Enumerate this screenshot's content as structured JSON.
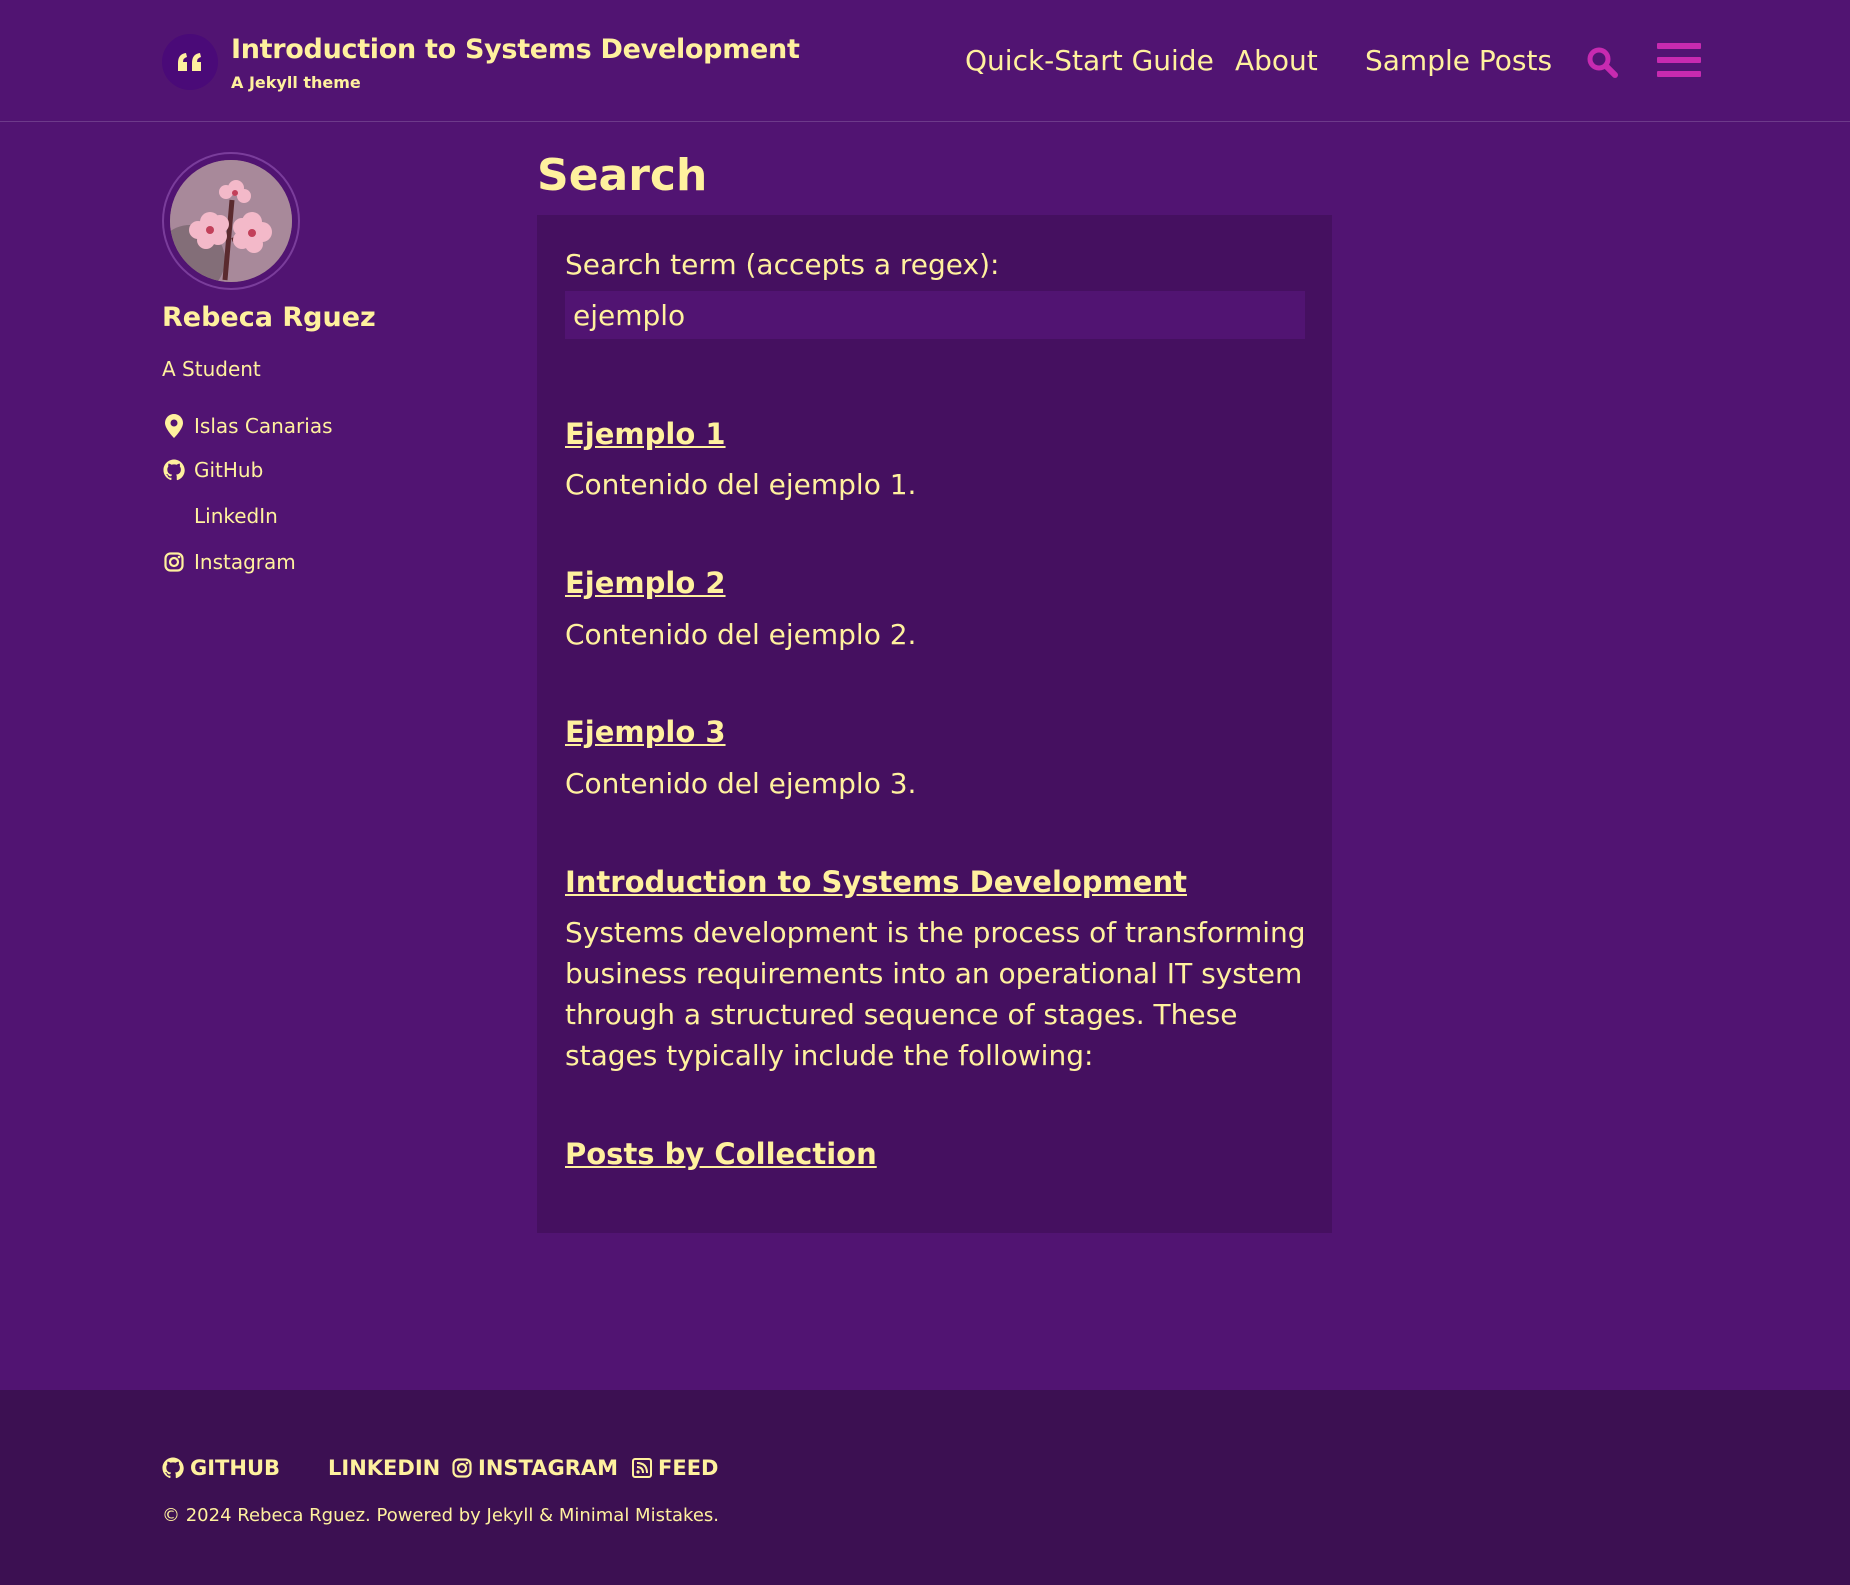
{
  "header": {
    "site_title": "Introduction to Systems Development",
    "site_subtitle": "A Jekyll theme",
    "nav": [
      "Quick-Start Guide",
      "About",
      "Sample Posts"
    ],
    "accent_color": "#c72ab0"
  },
  "sidebar": {
    "author_name": "Rebeca Rguez",
    "author_bio": "A Student",
    "links": [
      {
        "label": "Islas Canarias",
        "icon": "map-marker-icon"
      },
      {
        "label": "GitHub",
        "icon": "github-icon"
      },
      {
        "label": "LinkedIn",
        "icon": "linkedin-icon"
      },
      {
        "label": "Instagram",
        "icon": "instagram-icon"
      }
    ]
  },
  "main": {
    "page_title": "Search",
    "search_label": "Search term (accepts a regex):",
    "search_value": "ejemplo",
    "results": [
      {
        "title": "Ejemplo 1",
        "excerpt": "Contenido del ejemplo 1."
      },
      {
        "title": "Ejemplo 2",
        "excerpt": "Contenido del ejemplo 2."
      },
      {
        "title": "Ejemplo 3",
        "excerpt": "Contenido del ejemplo 3."
      },
      {
        "title": "Introduction to Systems Development",
        "excerpt": "Systems development is the process of transforming business requirements into an operational IT system through a structured sequence of stages. These stages typically include the following:"
      },
      {
        "title": "Posts by Collection",
        "excerpt": ""
      }
    ]
  },
  "footer": {
    "links": [
      "GitHub",
      "LinkedIn",
      "Instagram",
      "Feed"
    ],
    "copyright": "© 2024 Rebeca Rguez. Powered by Jekyll & Minimal Mistakes."
  }
}
